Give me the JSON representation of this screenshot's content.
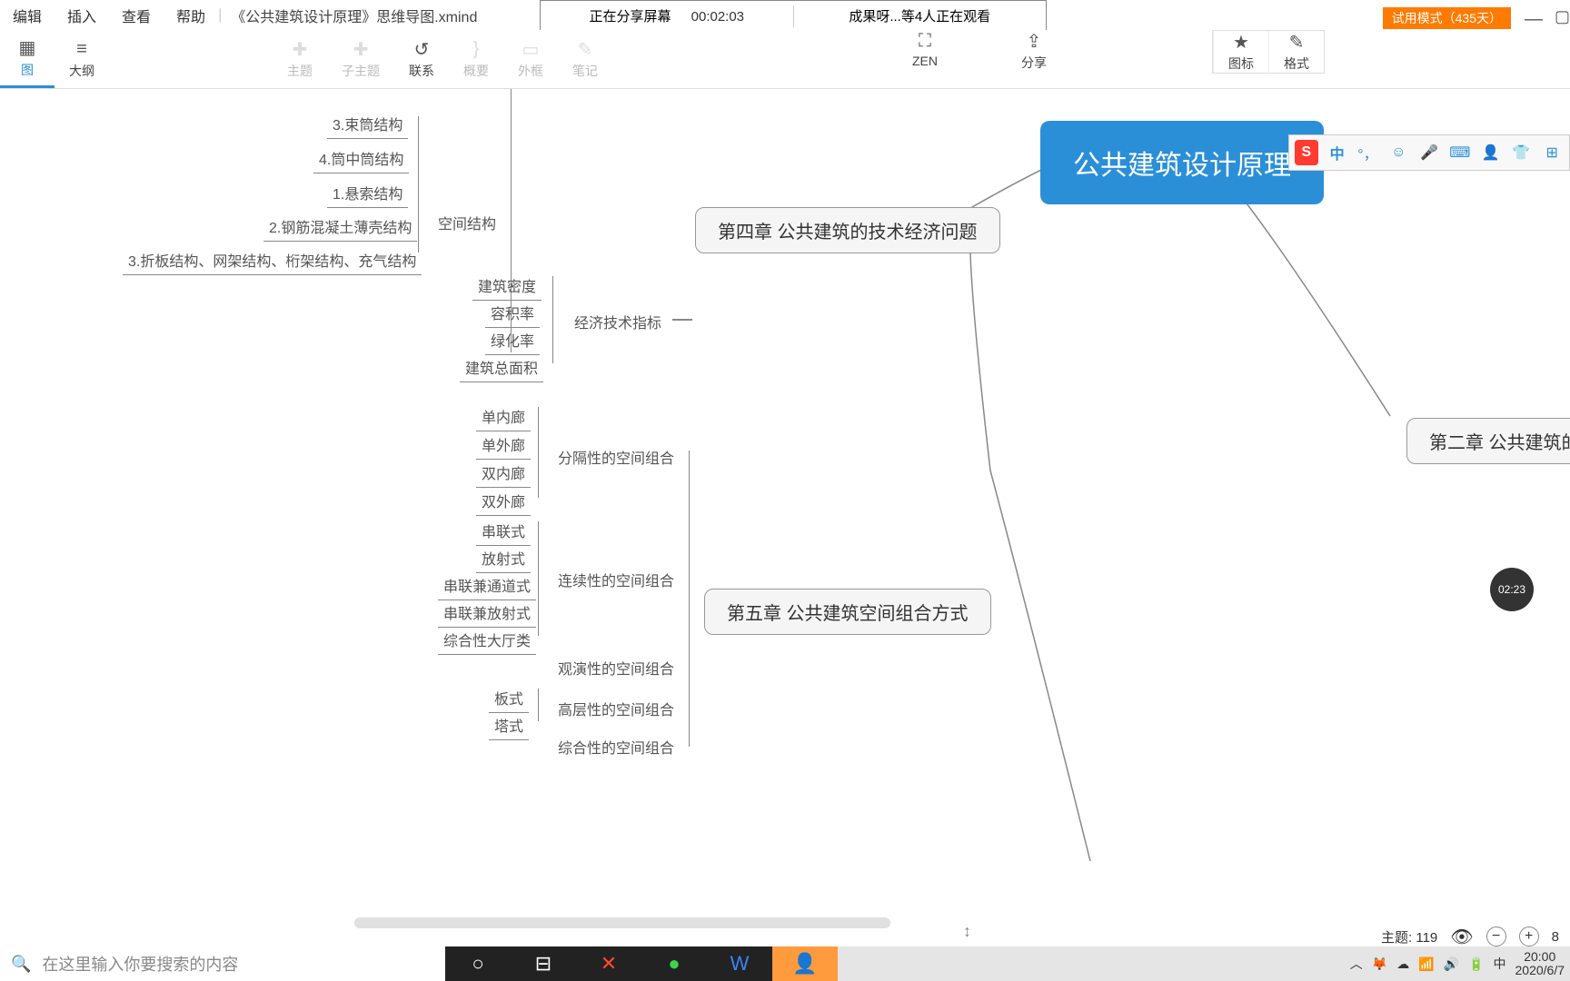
{
  "menu": {
    "edit": "编辑",
    "insert": "插入",
    "view": "查看",
    "help": "帮助",
    "filename": "《公共建筑设计原理》思维导图.xmind"
  },
  "trial": "试用模式（435天）",
  "share": {
    "label": "正在分享屏幕",
    "time": "00:02:03",
    "viewers": "成果呀...等4人正在观看"
  },
  "toolbar": {
    "map": "图",
    "outline": "大纲",
    "topic": "主题",
    "subtopic": "子主题",
    "relation": "联系",
    "summary": "概要",
    "boundary": "外框",
    "note": "笔记",
    "zen": "ZEN",
    "share": "分享",
    "icon": "图标",
    "format": "格式"
  },
  "nodes": {
    "root": "公共建筑设计原理",
    "ch4": "第四章 公共建筑的技术经济问题",
    "ch5": "第五章 公共建筑空间组合方式",
    "ch2": "第二章 公共建筑的功",
    "spaceStruct": "空间结构",
    "econIndex": "经济技术指标",
    "sep": "分隔性的空间组合",
    "cont": "连续性的空间组合",
    "view": "观演性的空间组合",
    "high": "高层性的空间组合",
    "comp": "综合性的空间组合",
    "s1": "3.束筒结构",
    "s2": "4.筒中筒结构",
    "s3": "1.悬索结构",
    "s4": "2.钢筋混凝土薄壳结构",
    "s5": "3.折板结构、网架结构、桁架结构、充气结构",
    "e1": "建筑密度",
    "e2": "容积率",
    "e3": "绿化率",
    "e4": "建筑总面积",
    "c1": "单内廊",
    "c2": "单外廊",
    "c3": "双内廊",
    "c4": "双外廊",
    "l1": "串联式",
    "l2": "放射式",
    "l3": "串联兼通道式",
    "l4": "串联兼放射式",
    "l5": "综合性大厅类",
    "h1": "板式",
    "h2": "塔式"
  },
  "ime": {
    "logo": "S",
    "lang": "中"
  },
  "bubble": "02:23",
  "status": {
    "topics": "主题: 119"
  },
  "taskbar": {
    "search": "在这里输入你要搜索的内容",
    "time": "20:00",
    "date": "2020/6/7",
    "lang": "中"
  }
}
